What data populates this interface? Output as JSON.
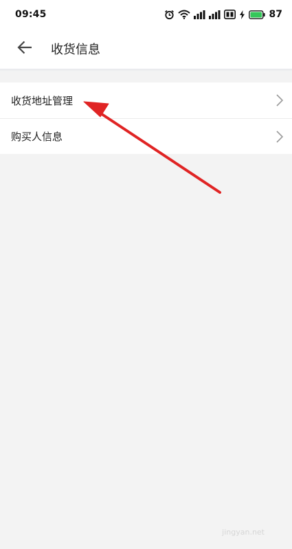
{
  "status_bar": {
    "time": "09:45",
    "icons": [
      "alarm-icon",
      "wifi-icon",
      "signal-icon",
      "signal-icon",
      "data-icon",
      "charging-icon",
      "battery-icon"
    ],
    "battery_level": "87",
    "battery_color": "#34c759"
  },
  "header": {
    "title": "收货信息",
    "back_icon": "arrow-left-icon"
  },
  "menu": {
    "items": [
      {
        "label": "收货地址管理"
      },
      {
        "label": "购买人信息"
      }
    ]
  },
  "annotation": {
    "color": "#e02424"
  },
  "watermark": {
    "text": "jingyan.net"
  }
}
